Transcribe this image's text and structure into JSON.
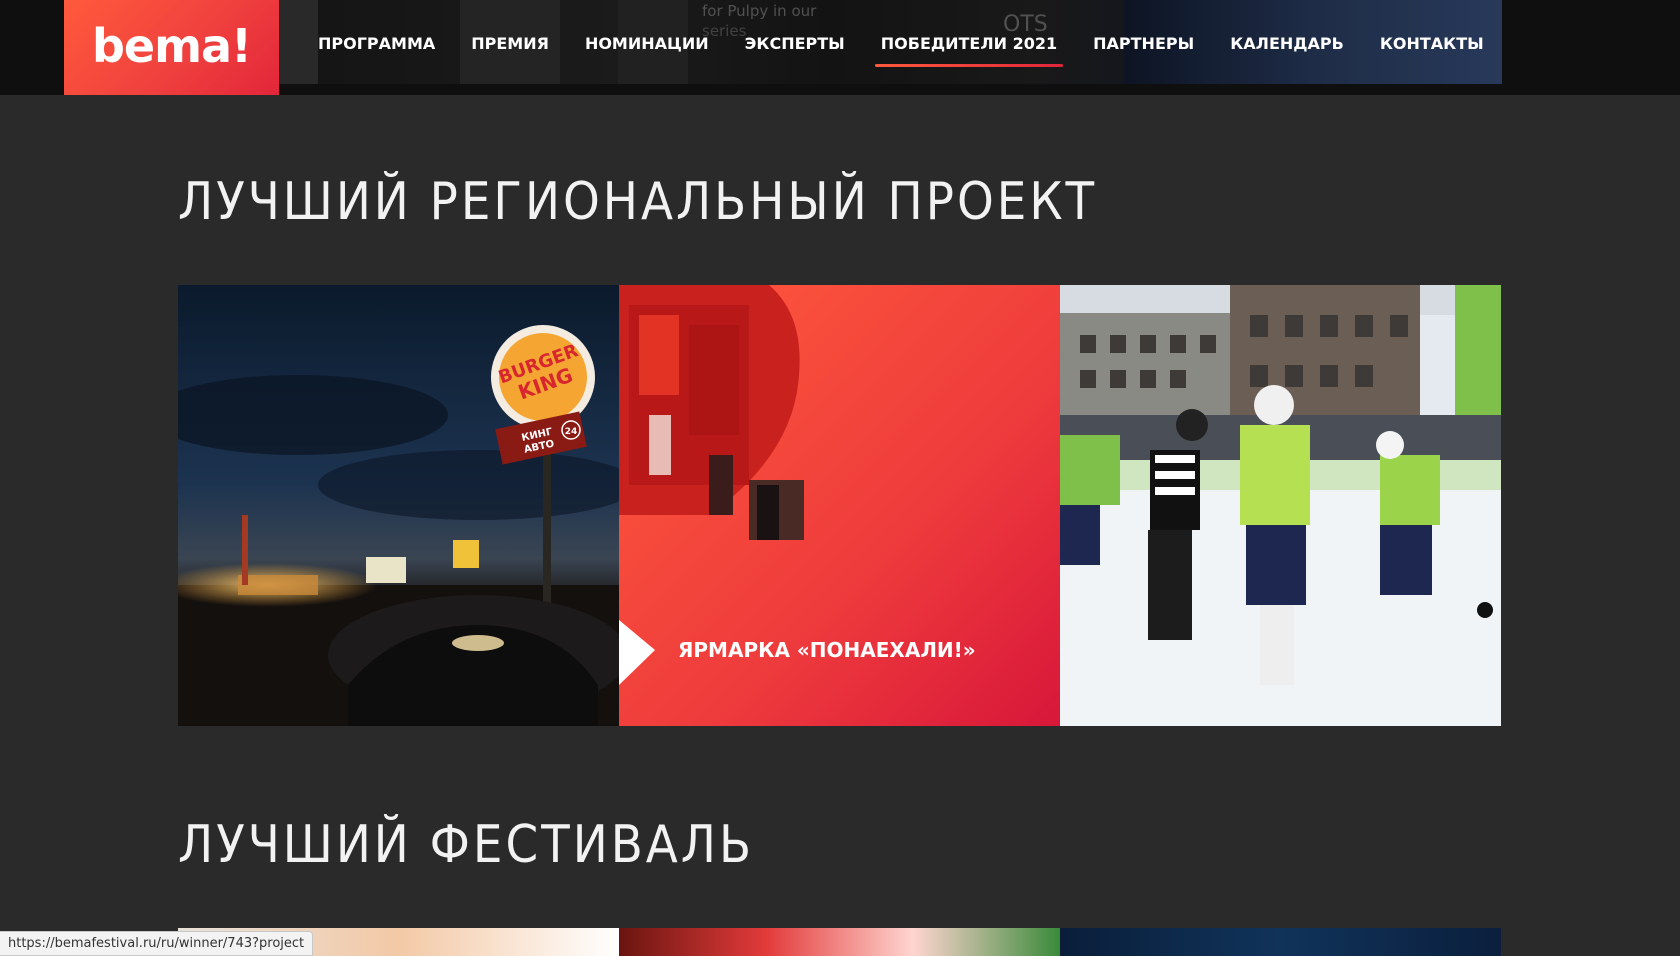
{
  "header": {
    "logo_text": "bema!",
    "strip_text_1": "for Pulpy in our",
    "strip_text_2": "series",
    "strip_text_3": "OTS",
    "nav": [
      {
        "label": "ПРОГРАММА"
      },
      {
        "label": "ПРЕМИЯ"
      },
      {
        "label": "НОМИНАЦИИ"
      },
      {
        "label": "ЭКСПЕРТЫ"
      },
      {
        "label": "ПОБЕДИТЕЛИ 2021",
        "active": true
      },
      {
        "label": "ПАРТНЕРЫ"
      },
      {
        "label": "КАЛЕНДАРЬ"
      },
      {
        "label": "КОНТАКТЫ"
      }
    ]
  },
  "sections": [
    {
      "title": "ЛУЧШИЙ РЕГИОНАЛЬНЫЙ ПРОЕКТ",
      "cards": [
        {
          "image": "burger-king-drive-in-night",
          "sign_text_1": "BURGER",
          "sign_text_2": "KING",
          "sub_sign_text_1": "КИНГ",
          "sub_sign_text_2": "АВТО",
          "sub_sign_badge": "24"
        },
        {
          "image": "fair-ponaekhali-red-2",
          "caption": "ЯРМАРКА «ПОНАЕХАЛИ!»"
        },
        {
          "image": "ice-hockey-match-outdoor"
        }
      ]
    },
    {
      "title": "ЛУЧШИЙ ФЕСТИВАЛЬ"
    }
  ],
  "status_bar": {
    "url": "https://bemafestival.ru/ru/winner/743?project"
  },
  "colors": {
    "background": "#2a2a2a",
    "header": "#0f0f0f",
    "accent_start": "#ff5a3c",
    "accent_end": "#e2263a"
  }
}
